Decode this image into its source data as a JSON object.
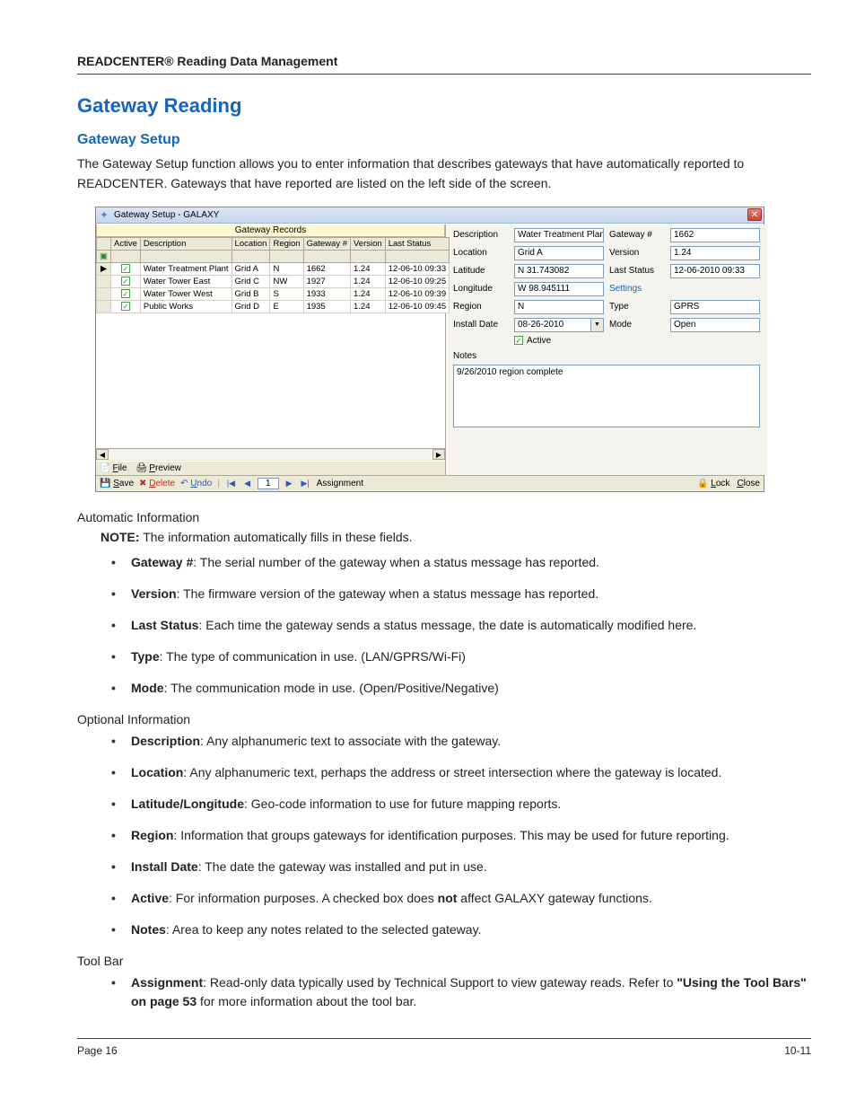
{
  "header": "READCENTER® Reading Data Management",
  "section_title": "Gateway Reading",
  "sub_title": "Gateway Setup",
  "intro": "The Gateway Setup function allows you to enter information that describes gateways that have automatically reported to READCENTER. Gateways that have reported are listed on the left side of the screen.",
  "footer_left": "Page 16",
  "footer_right": "10-11",
  "screenshot": {
    "title": "Gateway Setup - GALAXY",
    "records_header": "Gateway Records",
    "columns": [
      "Active",
      "Description",
      "Location",
      "Region",
      "Gateway #",
      "Version",
      "Last Status"
    ],
    "rows": [
      {
        "active": true,
        "desc": "Water Treatment Plant",
        "loc": "Grid A",
        "region": "N",
        "gw": "1662",
        "ver": "1.24",
        "status": "12-06-10 09:33"
      },
      {
        "active": true,
        "desc": "Water Tower East",
        "loc": "Grid C",
        "region": "NW",
        "gw": "1927",
        "ver": "1.24",
        "status": "12-06-10 09:25"
      },
      {
        "active": true,
        "desc": "Water Tower West",
        "loc": "Grid B",
        "region": "S",
        "gw": "1933",
        "ver": "1.24",
        "status": "12-06-10 09:39"
      },
      {
        "active": true,
        "desc": "Public Works",
        "loc": "Grid D",
        "region": "E",
        "gw": "1935",
        "ver": "1.24",
        "status": "12-06-10 09:45"
      }
    ],
    "filebar": {
      "file": "File",
      "preview": "Preview"
    },
    "form": {
      "description_label": "Description",
      "description_value": "Water Treatment Plant",
      "gateway_label": "Gateway #",
      "gateway_value": "1662",
      "location_label": "Location",
      "location_value": "Grid A",
      "version_label": "Version",
      "version_value": "1.24",
      "latitude_label": "Latitude",
      "latitude_value": "N 31.743082",
      "laststatus_label": "Last Status",
      "laststatus_value": "12-06-2010 09:33",
      "longitude_label": "Longitude",
      "longitude_value": "W 98.945111",
      "settings_label": "Settings",
      "region_label": "Region",
      "region_value": "N",
      "type_label": "Type",
      "type_value": "GPRS",
      "install_label": "Install Date",
      "install_value": "08-26-2010",
      "mode_label": "Mode",
      "mode_value": "Open",
      "active_label": "Active",
      "notes_label": "Notes",
      "notes_value": "9/26/2010 region complete"
    },
    "bottombar": {
      "save": "Save",
      "delete": "Delete",
      "undo": "Undo",
      "page": "1",
      "assignment": "Assignment",
      "lock": "Lock",
      "close": "Close"
    }
  },
  "auto_heading": "Automatic Information",
  "note_prefix": "NOTE:",
  "note_text": " The information automatically fills in these fields.",
  "auto_items": [
    {
      "term": "Gateway #",
      "def": ": The serial number of the gateway when a status message has reported."
    },
    {
      "term": "Version",
      "def": ": The firmware version of the gateway when a status message has reported."
    },
    {
      "term": "Last Status",
      "def": ": Each time the gateway sends a status message, the date is automatically modified here."
    },
    {
      "term": "Type",
      "def": ": The type of communication in use. (LAN/GPRS/Wi-Fi)"
    },
    {
      "term": "Mode",
      "def": ": The communication mode in use. (Open/Positive/Negative)"
    }
  ],
  "opt_heading": "Optional Information",
  "opt_items": [
    {
      "term": "Description",
      "def": ": Any alphanumeric text to associate with the gateway."
    },
    {
      "term": "Location",
      "def": ": Any alphanumeric text, perhaps the address or street intersection where the gateway is located."
    },
    {
      "term": "Latitude/Longitude",
      "def": ": Geo-code information to use for future mapping reports."
    },
    {
      "term": "Region",
      "def": ": Information that groups gateways for identification purposes. This may be used for future reporting."
    },
    {
      "term": "Install Date",
      "def": ": The date the gateway was installed and put in use."
    },
    {
      "term": "Active",
      "pre": ": For information purposes. A checked box does ",
      "bold": "not",
      "post": " affect GALAXY gateway functions."
    },
    {
      "term": "Notes",
      "def": ":  Area to keep any notes related to the selected gateway."
    }
  ],
  "toolbar_heading": "Tool Bar",
  "toolbar_item": {
    "term": "Assignment",
    "pre": ":  Read-only data typically used by Technical Support to view gateway reads. Refer to  ",
    "link": "\"Using the Tool Bars\" on page 53",
    "post": " for more information about the tool bar."
  }
}
